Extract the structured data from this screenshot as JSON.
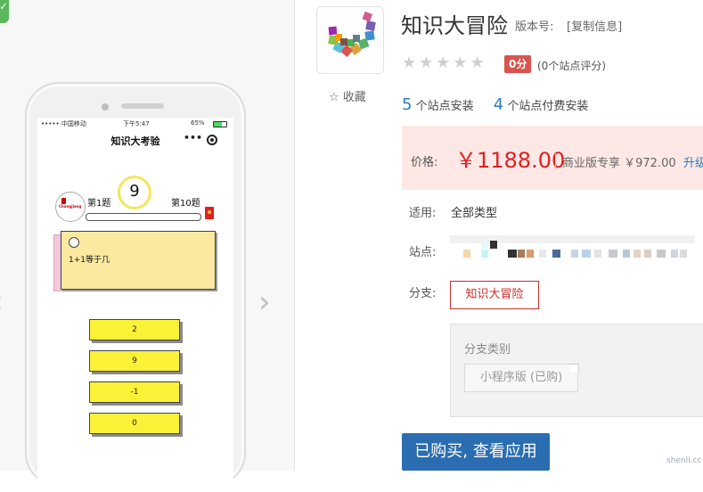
{
  "preview": {
    "status_carrier": "••••• 中国移动",
    "status_time": "下午5:47",
    "status_battery": "65%",
    "nav_title": "知识大考验",
    "nav_dots": "•••",
    "avatar_logo": "Changjiang",
    "timer_value": "9",
    "question_first": "第1题",
    "question_last": "第10题",
    "question_text": "1+1等于几",
    "answers": [
      "2",
      "9",
      "-1",
      "0"
    ]
  },
  "app": {
    "name": "知识大冒险",
    "version_label": "版本号:",
    "copy_info": "[复制信息]",
    "stars": "★★★★★",
    "score": "0分",
    "score_count": "(0个站点评分)",
    "favorite": "☆ 收藏",
    "installs_count": "5",
    "installs_label": "个站点安装",
    "paid_count": "4",
    "paid_label": "个站点付费安装"
  },
  "price": {
    "label": "价格:",
    "value": "￥1188.00",
    "biz_text": "商业版专享 ￥972.00",
    "upgrade": "升级"
  },
  "details": {
    "apply_label": "适用:",
    "apply_value": "全部类型",
    "site_label": "站点:",
    "branch_label": "分支:",
    "branch_value": "知识大冒险",
    "branch_category_label": "分支类别",
    "branch_type": "小程序版 (已购)"
  },
  "buy_button": "已购买, 查看应用",
  "watermark": "shenli.cc",
  "colors": {
    "price_red": "#e02020",
    "accent_blue": "#2e7bbd",
    "buy_blue": "#2a6db0",
    "answer_yellow": "#fbf238"
  }
}
